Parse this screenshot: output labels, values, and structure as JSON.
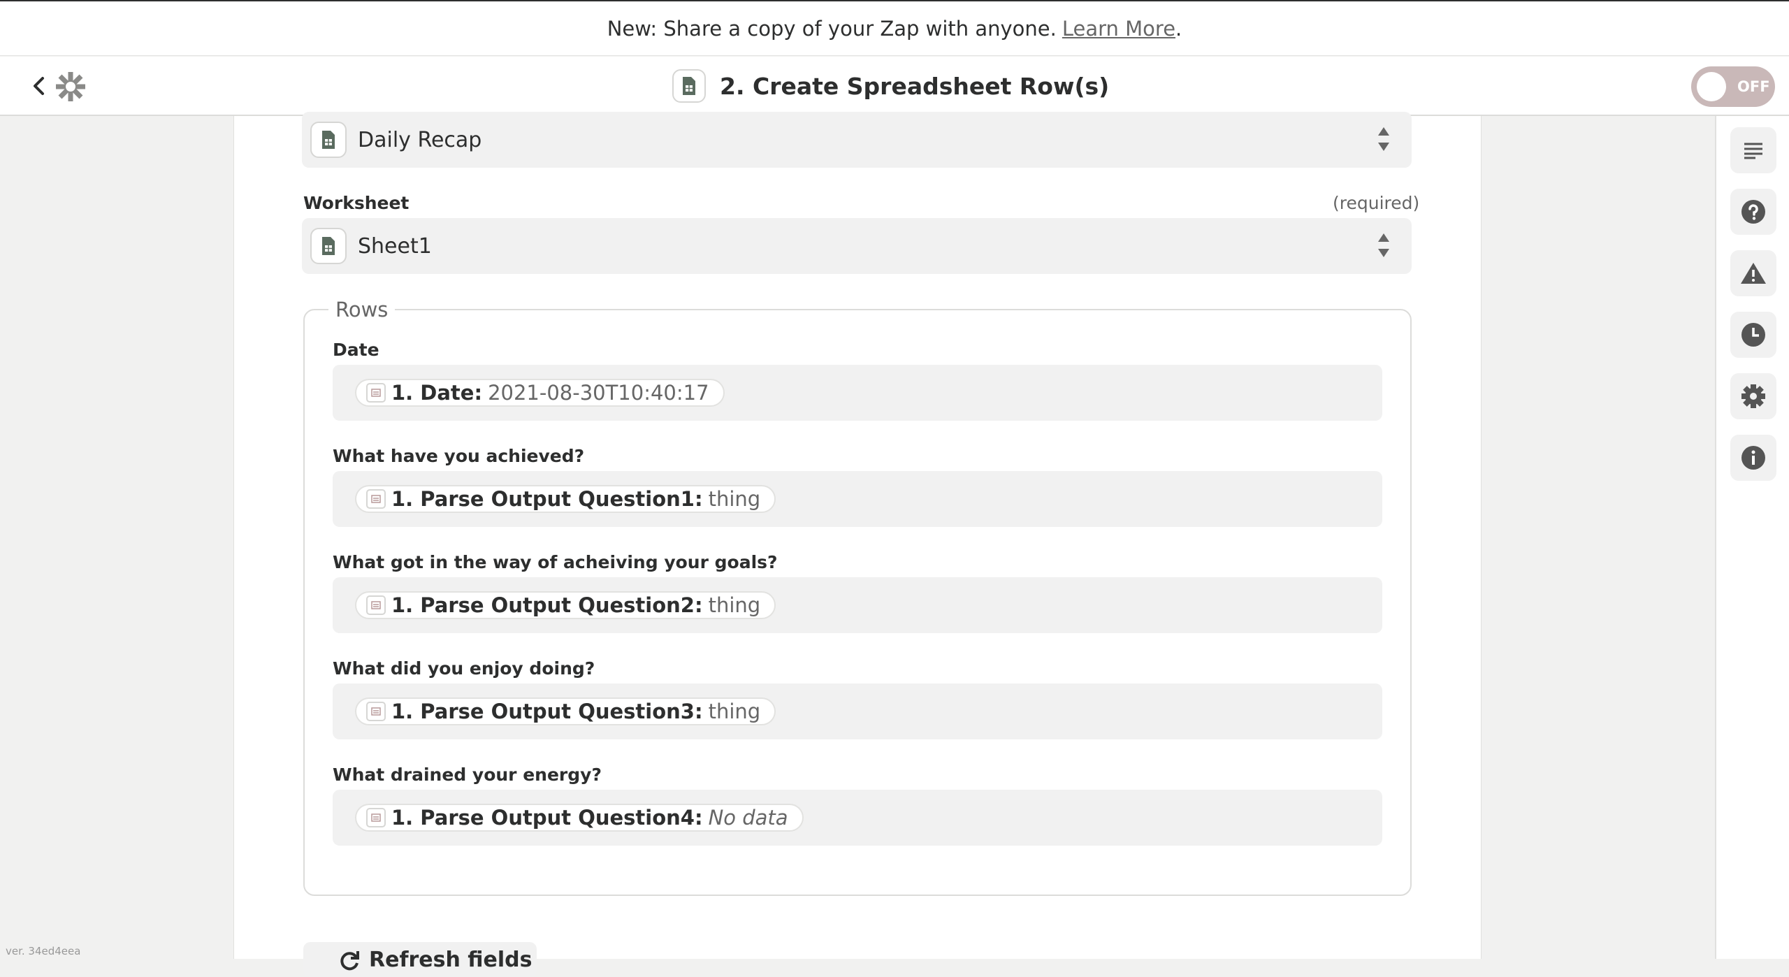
{
  "banner": {
    "text": "New: Share a copy of your Zap with anyone.",
    "link": "Learn More",
    "suffix": "."
  },
  "header": {
    "step_title": "2. Create Spreadsheet Row(s)",
    "toggle_label": "OFF"
  },
  "form": {
    "spreadsheet_value": "Daily Recap",
    "worksheet": {
      "label": "Worksheet",
      "required": "(required)",
      "value": "Sheet1"
    },
    "rows_legend": "Rows",
    "rows": [
      {
        "label": "Date",
        "key": "1. Date:",
        "value": "2021-08-30T10:40:17",
        "nodata": false
      },
      {
        "label": "What have you achieved?",
        "key": "1. Parse Output Question1:",
        "value": "thing",
        "nodata": false
      },
      {
        "label": "What got in the way of acheiving your goals?",
        "key": "1. Parse Output Question2:",
        "value": "thing",
        "nodata": false
      },
      {
        "label": "What did you enjoy doing?",
        "key": "1. Parse Output Question3:",
        "value": "thing",
        "nodata": false
      },
      {
        "label": "What drained your energy?",
        "key": "1. Parse Output Question4:",
        "value": "No data",
        "nodata": true
      }
    ],
    "refresh_label": "Refresh fields"
  },
  "version": "ver. 34ed4eea",
  "sidebar_icons": [
    "outline-icon",
    "help-icon",
    "warning-icon",
    "history-icon",
    "settings-icon",
    "info-icon"
  ],
  "colors": {
    "toggle_off": "#c9b8b8",
    "sheets_green": "#5a6b5f",
    "panel_bg": "#f1f1f0"
  }
}
